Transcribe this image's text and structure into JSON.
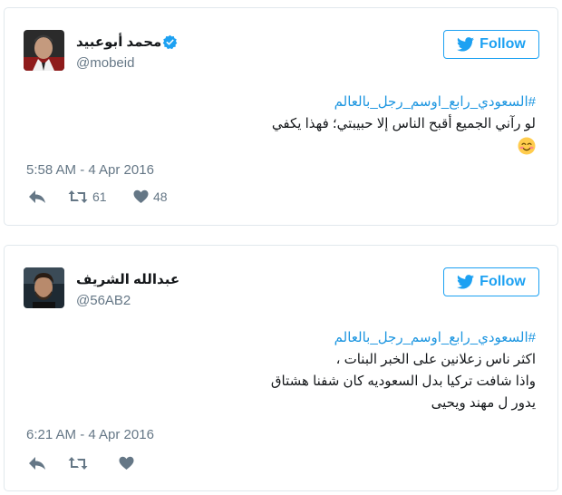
{
  "colors": {
    "accent": "#1da1f2",
    "hashtag": "#1b95e0",
    "muted": "#657786"
  },
  "tweets": [
    {
      "name": "محمد أبوعبيد",
      "verified": true,
      "handle": "@mobeid",
      "follow_label": "Follow",
      "hashtag": "#السعودي_رابع_اوسم_رجل_بالعالم",
      "lines": [
        "لو رآني الجميع أقبح الناس إلا حبيبتي؛ فهذا يكفي"
      ],
      "emoji": "smiling-face-with-blush-icon",
      "timestamp": "5:58 AM - 4 Apr 2016",
      "retweets": "61",
      "likes": "48"
    },
    {
      "name": "عبدالله الشريف",
      "verified": false,
      "handle": "@56AB2",
      "follow_label": "Follow",
      "hashtag": "#السعودي_رابع_اوسم_رجل_بالعالم",
      "lines": [
        "اكثر ناس زعلانين على الخبر البنات ،",
        "واذا شافت تركيا بدل السعوديه كان شفنا هشتاق",
        "يدور ل مهند ويحيى"
      ],
      "timestamp": "6:21 AM - 4 Apr 2016",
      "retweets": "",
      "likes": ""
    }
  ]
}
